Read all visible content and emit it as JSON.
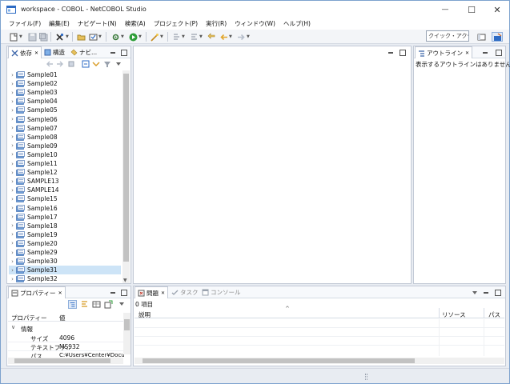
{
  "window": {
    "title": "workspace - COBOL - NetCOBOL Studio",
    "minimize": "—",
    "maximize": "☐",
    "close": "✕"
  },
  "menu": [
    "ファイル(F)",
    "編集(E)",
    "ナビゲート(N)",
    "検索(A)",
    "プロジェクト(P)",
    "実行(R)",
    "ウィンドウ(W)",
    "ヘルプ(H)"
  ],
  "toolbar": {
    "quick_access": "クイック・アクセス"
  },
  "explorer": {
    "tabs": [
      "依存",
      "構造",
      "ナビ..."
    ],
    "items": [
      "Sample01",
      "Sample02",
      "Sample03",
      "Sample04",
      "Sample05",
      "Sample06",
      "Sample07",
      "Sample08",
      "Sample09",
      "Sample10",
      "Sample11",
      "Sample12",
      "SAMPLE13",
      "SAMPLE14",
      "Sample15",
      "Sample16",
      "Sample17",
      "Sample18",
      "Sample19",
      "Sample20",
      "Sample29",
      "Sample30",
      "Sample31",
      "Sample32"
    ],
    "selected_index": 22
  },
  "outline": {
    "tab": "アウトライン",
    "message": "表示するアウトラインはありません。"
  },
  "properties": {
    "tab": "プロパティー",
    "col_property": "プロパティー",
    "col_value": "値",
    "group": "情報",
    "rows": [
      {
        "name": "サイズ",
        "value": "4096"
      },
      {
        "name": "テキストファ..",
        "value": "MS932"
      },
      {
        "name": "パス",
        "value": "C:¥Users¥Center¥Docu..."
      }
    ]
  },
  "problems": {
    "tabs": [
      "問題",
      "タスク",
      "コンソール"
    ],
    "count": "0 項目",
    "columns": [
      "説明",
      "リソース",
      "パス"
    ]
  },
  "colors": {
    "accent": "#3c7fd6",
    "selection": "#cde4f7",
    "folder": "#6f9fd8"
  }
}
